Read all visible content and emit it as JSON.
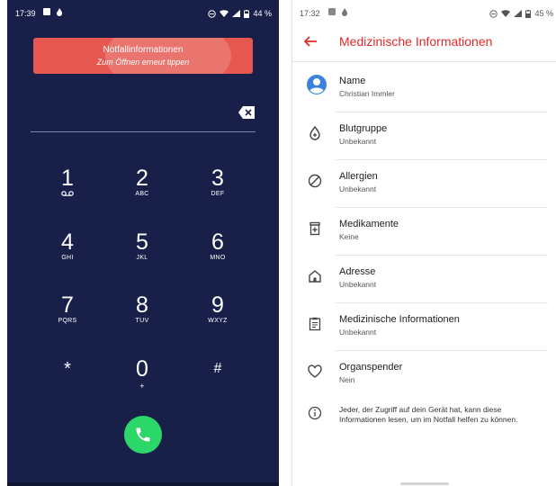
{
  "left": {
    "status": {
      "time": "17:39",
      "battery": "44 %"
    },
    "banner": {
      "title": "Notfallinformationen",
      "subtitle": "Zum Öffnen erneut tippen"
    },
    "keys": [
      {
        "digit": "1",
        "letters": ""
      },
      {
        "digit": "2",
        "letters": "ABC"
      },
      {
        "digit": "3",
        "letters": "DEF"
      },
      {
        "digit": "4",
        "letters": "GHI"
      },
      {
        "digit": "5",
        "letters": "JKL"
      },
      {
        "digit": "6",
        "letters": "MNO"
      },
      {
        "digit": "7",
        "letters": "PQRS"
      },
      {
        "digit": "8",
        "letters": "TUV"
      },
      {
        "digit": "9",
        "letters": "WXYZ"
      },
      {
        "digit": "*",
        "letters": ""
      },
      {
        "digit": "0",
        "letters": "+"
      },
      {
        "digit": "#",
        "letters": ""
      }
    ],
    "colors": {
      "background": "#18204a",
      "banner": "#e5574f",
      "call": "#2bd768"
    }
  },
  "right": {
    "status": {
      "time": "17:32",
      "battery": "45 %"
    },
    "title": "Medizinische Informationen",
    "rows": [
      {
        "icon": "account-icon",
        "title": "Name",
        "value": "Christian Immler"
      },
      {
        "icon": "blood-drop-icon",
        "title": "Blutgruppe",
        "value": "Unbekannt"
      },
      {
        "icon": "no-entry-icon",
        "title": "Allergien",
        "value": "Unbekannt"
      },
      {
        "icon": "medication-icon",
        "title": "Medikamente",
        "value": "Keine"
      },
      {
        "icon": "home-icon",
        "title": "Adresse",
        "value": "Unbekannt"
      },
      {
        "icon": "clipboard-icon",
        "title": "Medizinische Informationen",
        "value": "Unbekannt"
      },
      {
        "icon": "heart-icon",
        "title": "Organspender",
        "value": "Nein"
      }
    ],
    "info_text": "Jeder, der Zugriff auf dein Gerät hat, kann diese Informationen lesen, um im Notfall helfen zu können.",
    "colors": {
      "accent": "#e02a2a",
      "avatar": "#3b82e0"
    }
  }
}
